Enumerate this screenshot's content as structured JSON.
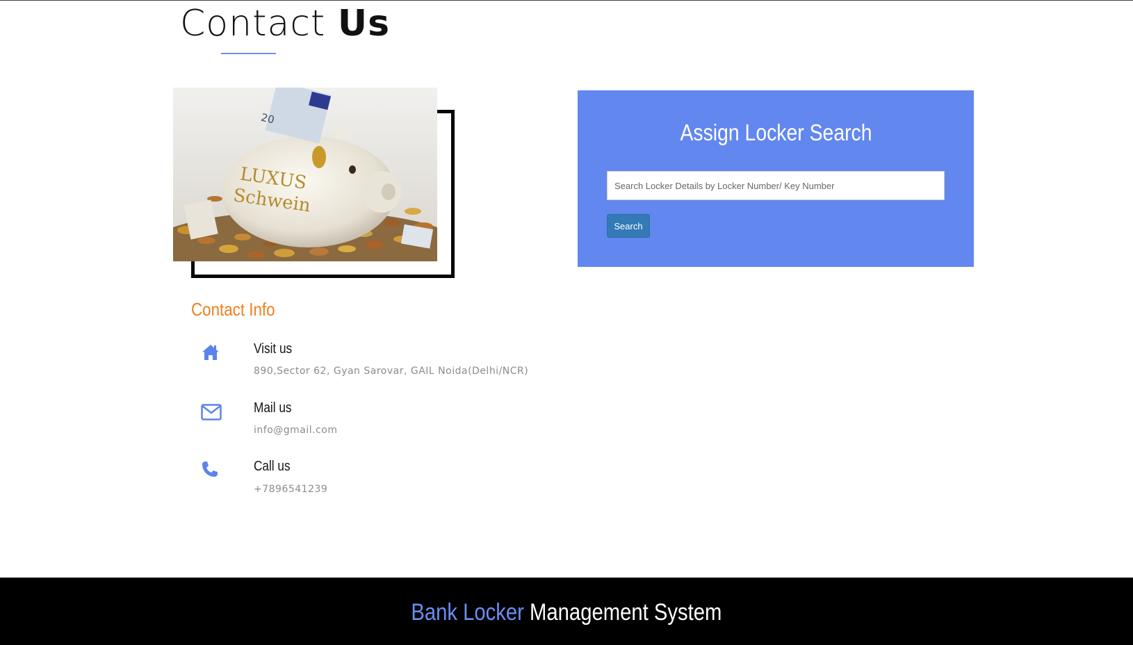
{
  "header": {
    "title_light": "Contact",
    "title_bold": "Us"
  },
  "contact_info": {
    "heading": "Contact Info",
    "items": [
      {
        "icon": "home-icon",
        "label": "Visit us",
        "value": "890,Sector 62, Gyan Sarovar, GAIL Noida(Delhi/NCR)"
      },
      {
        "icon": "mail-icon",
        "label": "Mail us",
        "value": "info@gmail.com"
      },
      {
        "icon": "phone-icon",
        "label": "Call us",
        "value": "+7896541239"
      }
    ]
  },
  "search": {
    "title": "Assign Locker Search",
    "placeholder": "Search Locker Details by Locker Number/ Key Number",
    "value": "",
    "button_label": "Search"
  },
  "footer": {
    "brand_accent": "Bank Locker",
    "brand_main": "Management System"
  },
  "colors": {
    "accent": "#6287ef",
    "orange": "#f07f1d",
    "button": "#337ab7"
  }
}
